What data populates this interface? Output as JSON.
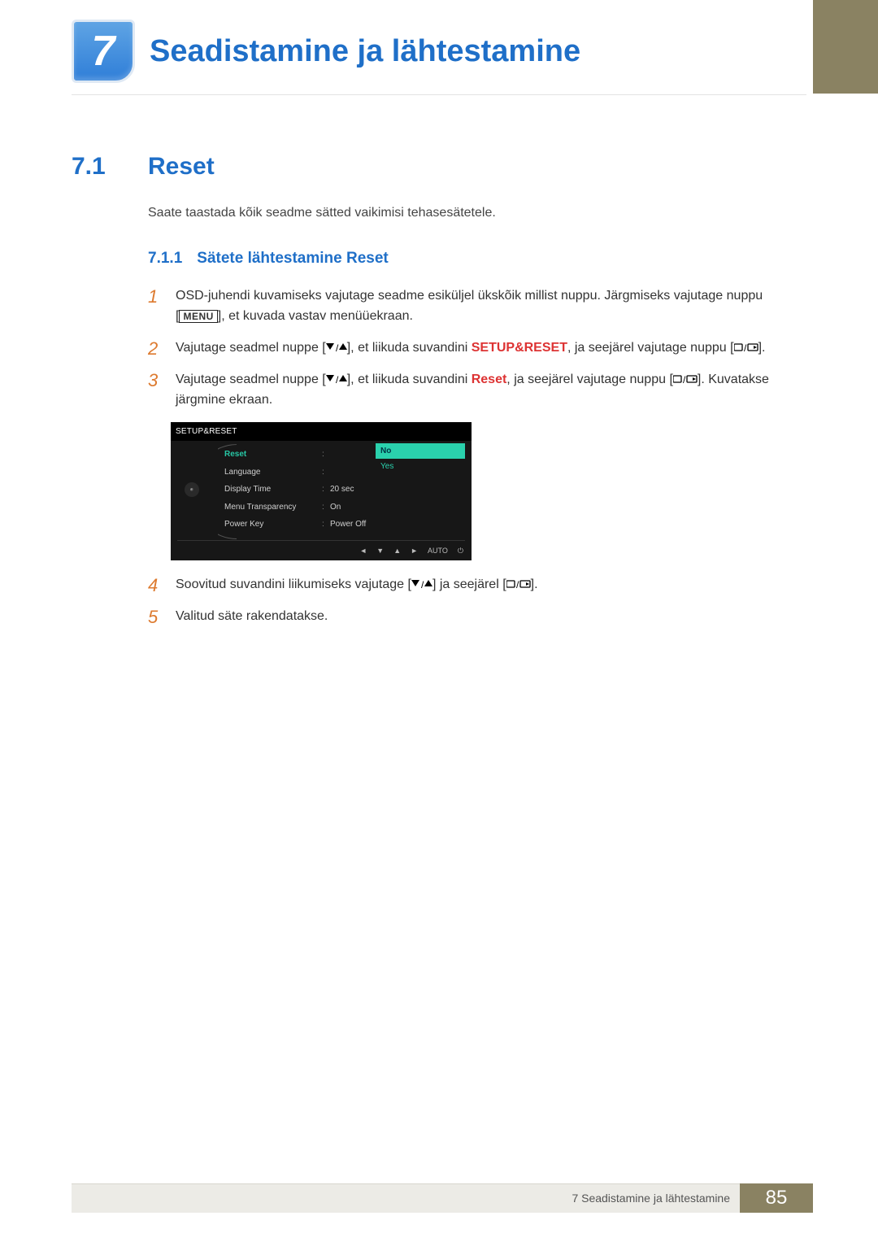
{
  "chapter": {
    "number": "7",
    "title": "Seadistamine ja lähtestamine"
  },
  "section": {
    "number": "7.1",
    "title": "Reset",
    "intro": "Saate taastada kõik seadme sätted vaikimisi tehasesätetele."
  },
  "subsection": {
    "number": "7.1.1",
    "title": "Sätete lähtestamine Reset"
  },
  "steps": {
    "s1a": "OSD-juhendi kuvamiseks vajutage seadme esiküljel ükskõik millist nuppu. Järgmiseks vajutage nuppu [",
    "s1b": "], et kuvada vastav menüüekraan.",
    "s1_menu": "MENU",
    "s2a": "Vajutage seadmel nuppe [",
    "s2b": "], et liikuda suvandini ",
    "s2c": ", ja seejärel vajutage nuppu [",
    "s2d": "].",
    "s2_kw": "SETUP&RESET",
    "s3a": "Vajutage seadmel nuppe [",
    "s3b": "], et liikuda suvandini ",
    "s3c": ", ja seejärel vajutage nuppu [",
    "s3d": "]. Kuvatakse järgmine ekraan.",
    "s3_kw": "Reset",
    "s4a": "Soovitud suvandini liikumiseks vajutage [",
    "s4b": "] ja seejärel [",
    "s4c": "].",
    "s5": "Valitud säte rakendatakse.",
    "n1": "1",
    "n2": "2",
    "n3": "3",
    "n4": "4",
    "n5": "5"
  },
  "osd": {
    "title": "SETUP&RESET",
    "rows": [
      {
        "label": "Reset",
        "value": ""
      },
      {
        "label": "Language",
        "value": ""
      },
      {
        "label": "Display Time",
        "value": "20 sec"
      },
      {
        "label": "Menu Transparency",
        "value": "On"
      },
      {
        "label": "Power Key",
        "value": "Power Off"
      }
    ],
    "popup": {
      "no": "No",
      "yes": "Yes"
    },
    "footer": {
      "auto": "AUTO"
    }
  },
  "footer": {
    "text": "7 Seadistamine ja lähtestamine",
    "page": "85"
  }
}
